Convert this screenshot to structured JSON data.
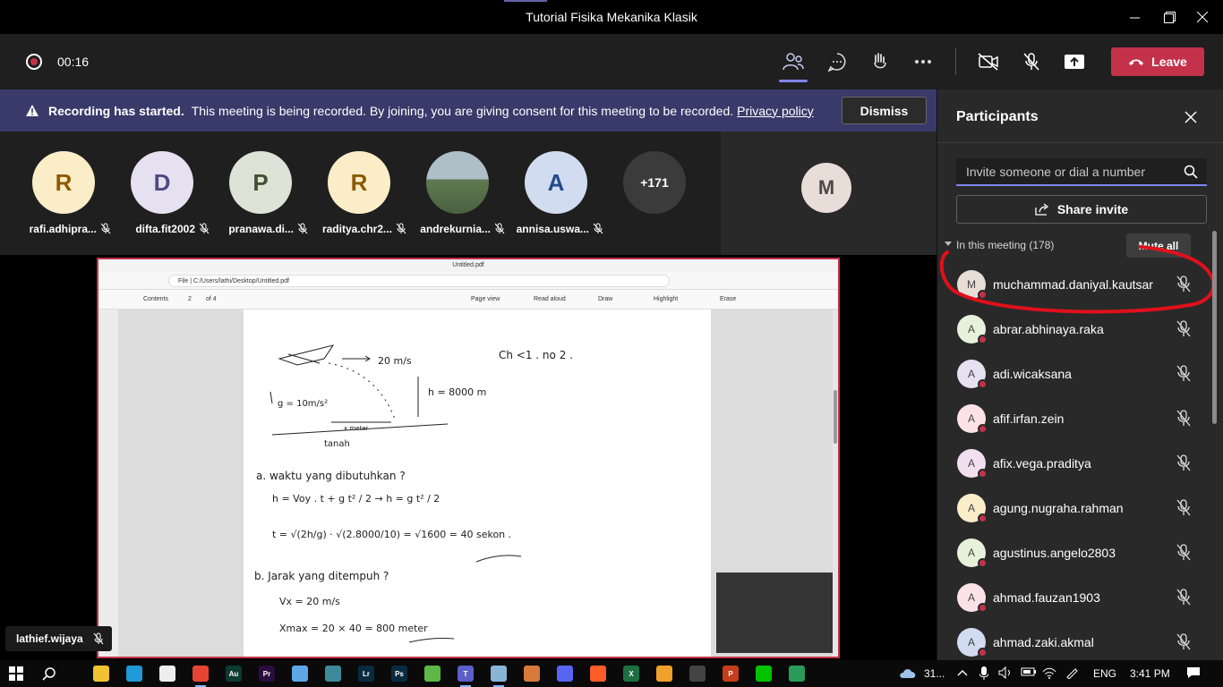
{
  "window": {
    "title": "Tutorial Fisika Mekanika Klasik"
  },
  "toolbar": {
    "timer": "00:16",
    "leave_label": "Leave"
  },
  "banner": {
    "bold_text": "Recording has started.",
    "text": "This meeting is being recorded. By joining, you are giving consent for this meeting to be recorded.",
    "link": "Privacy policy",
    "dismiss_label": "Dismiss"
  },
  "strip": {
    "tiles": [
      {
        "initial": "R",
        "name": "rafi.adhipra...",
        "bg": "#fcedc9",
        "fg": "#8a5b00"
      },
      {
        "initial": "D",
        "name": "difta.fit2002",
        "bg": "#e5e1f1",
        "fg": "#4f4980"
      },
      {
        "initial": "P",
        "name": "pranawa.di...",
        "bg": "#dee3d8",
        "fg": "#3f5330"
      },
      {
        "initial": "R",
        "name": "raditya.chr2...",
        "bg": "#fcedc9",
        "fg": "#8a5b00"
      },
      {
        "initial": "",
        "name": "andrekurnia...",
        "bg": "#7b8f98",
        "fg": "#ffffff"
      },
      {
        "initial": "A",
        "name": "annisa.uswa...",
        "bg": "#d1dcf0",
        "fg": "#244a8a"
      }
    ],
    "extra_count": "+171",
    "self_initial": "M"
  },
  "share": {
    "presenter": "lathief.wijaya",
    "pdf_tab": "Untitled.pdf",
    "pdf_url": "File  |  C:/Users/lathi/Desktop/Untitled.pdf",
    "pdf_tools": {
      "contents": "Contents",
      "page": "2",
      "of": "of 4",
      "page_view": "Page view",
      "read_aloud": "Read aloud",
      "draw": "Draw",
      "highlight": "Highlight",
      "erase": "Erase"
    },
    "notes": {
      "heading": "Ch <1 . no 2 .",
      "speed": "20 m/s",
      "height": "h = 8000 m",
      "gravity": "g = 10m/s²",
      "x_label": "x meter",
      "ground": "tanah",
      "qa": "a. waktu yang dibutuhkan ?",
      "eq1": "h = Voy . t + g t² / 2   →   h = g t² / 2",
      "eq2": "t = √(2h/g) · √(2.8000/10) = √1600 = 40 sekon .",
      "qb": "b. Jarak yang ditempuh ?",
      "vx": "Vx = 20 m/s",
      "xmax": "Xmax = 20 × 40 = 800 meter"
    }
  },
  "panel": {
    "title": "Participants",
    "invite_placeholder": "Invite someone or dial a number",
    "share_invite_label": "Share invite",
    "section_label": "In this meeting (178)",
    "mute_all_label": "Mute all",
    "participants": [
      {
        "initial": "M",
        "name": "muchammad.daniyal.kautsar",
        "bg": "#e9ddd8"
      },
      {
        "initial": "A",
        "name": "abrar.abhinaya.raka",
        "bg": "#e7f2da"
      },
      {
        "initial": "A",
        "name": "adi.wicaksana",
        "bg": "#e5e1f1"
      },
      {
        "initial": "A",
        "name": "afif.irfan.zein",
        "bg": "#fbe2e6"
      },
      {
        "initial": "A",
        "name": "afix.vega.praditya",
        "bg": "#f2e0f0"
      },
      {
        "initial": "A",
        "name": "agung.nugraha.rahman",
        "bg": "#fcedc9"
      },
      {
        "initial": "A",
        "name": "agustinus.angelo2803",
        "bg": "#e7f2da"
      },
      {
        "initial": "A",
        "name": "ahmad.fauzan1903",
        "bg": "#fbe2e6"
      },
      {
        "initial": "A",
        "name": "ahmad.zaki.akmal",
        "bg": "#d1dcf0"
      }
    ]
  },
  "taskbar": {
    "weather": "31...",
    "language": "ENG",
    "time": "3:41 PM"
  },
  "colors": {
    "accent": "#6264a7",
    "leave": "#c4314b",
    "banner": "#383a6a"
  }
}
